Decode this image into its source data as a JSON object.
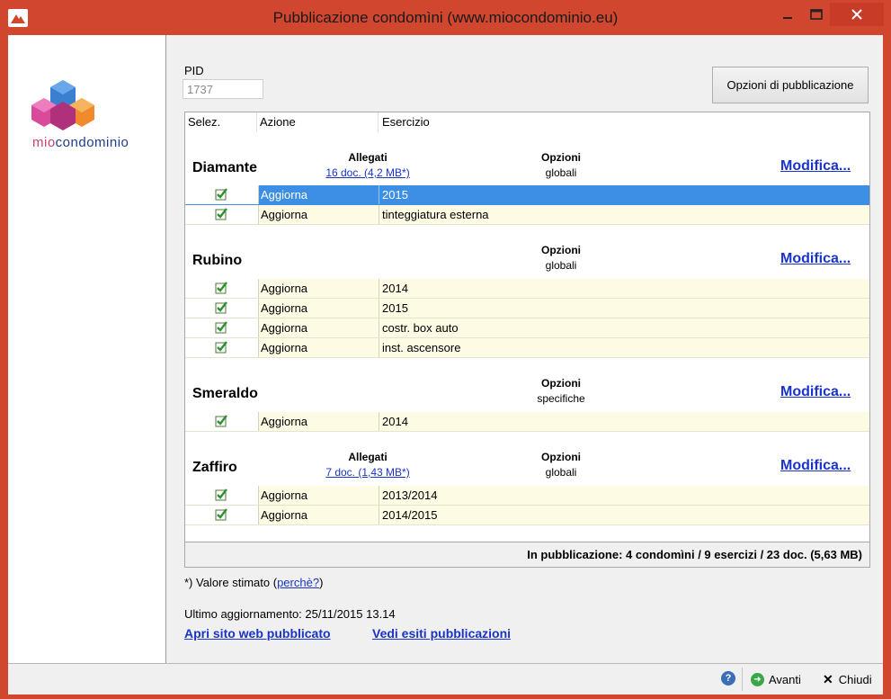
{
  "window": {
    "title": "Pubblicazione condomìni (www.miocondominio.eu)"
  },
  "logo": {
    "text_a": "mio",
    "text_b": "condominio"
  },
  "pid": {
    "label": "PID",
    "value": "1737"
  },
  "buttons": {
    "publish_options": "Opzioni di pubblicazione"
  },
  "grid": {
    "headers": {
      "selez": "Selez.",
      "azione": "Azione",
      "esercizio": "Esercizio"
    },
    "groups": [
      {
        "name": "Diamante",
        "allegati_label": "Allegati",
        "allegati_link": "16 doc. (4,2 MB*)",
        "opzioni_label": "Opzioni",
        "opzioni_value": "globali",
        "modify": "Modifica...",
        "rows": [
          {
            "azione": "Aggiorna",
            "esercizio": "2015",
            "checked": true,
            "selected": true
          },
          {
            "azione": "Aggiorna",
            "esercizio": "tinteggiatura esterna",
            "checked": true
          }
        ]
      },
      {
        "name": "Rubino",
        "opzioni_label": "Opzioni",
        "opzioni_value": "globali",
        "modify": "Modifica...",
        "rows": [
          {
            "azione": "Aggiorna",
            "esercizio": "2014",
            "checked": true
          },
          {
            "azione": "Aggiorna",
            "esercizio": "2015",
            "checked": true
          },
          {
            "azione": "Aggiorna",
            "esercizio": "costr. box auto",
            "checked": true
          },
          {
            "azione": "Aggiorna",
            "esercizio": "inst. ascensore",
            "checked": true
          }
        ]
      },
      {
        "name": "Smeraldo",
        "opzioni_label": "Opzioni",
        "opzioni_value": "specifiche",
        "modify": "Modifica...",
        "rows": [
          {
            "azione": "Aggiorna",
            "esercizio": "2014",
            "checked": true
          }
        ]
      },
      {
        "name": "Zaffiro",
        "allegati_label": "Allegati",
        "allegati_link": "7 doc. (1,43 MB*)",
        "opzioni_label": "Opzioni",
        "opzioni_value": "globali",
        "modify": "Modifica...",
        "rows": [
          {
            "azione": "Aggiorna",
            "esercizio": "2013/2014",
            "checked": true
          },
          {
            "azione": "Aggiorna",
            "esercizio": "2014/2015",
            "checked": true
          }
        ]
      }
    ],
    "summary": "In pubblicazione: 4 condomìni / 9 esercizi / 23 doc. (5,63 MB)"
  },
  "note": {
    "prefix": "*) Valore stimato (",
    "link": "perchè?",
    "suffix": ")"
  },
  "last_update": "Ultimo aggiornamento: 25/11/2015  13.14",
  "links": {
    "open_site": "Apri sito web pubblicato",
    "view_results": "Vedi esiti pubblicazioni"
  },
  "footer": {
    "help": "?",
    "next": "Avanti",
    "close": "Chiudi"
  }
}
